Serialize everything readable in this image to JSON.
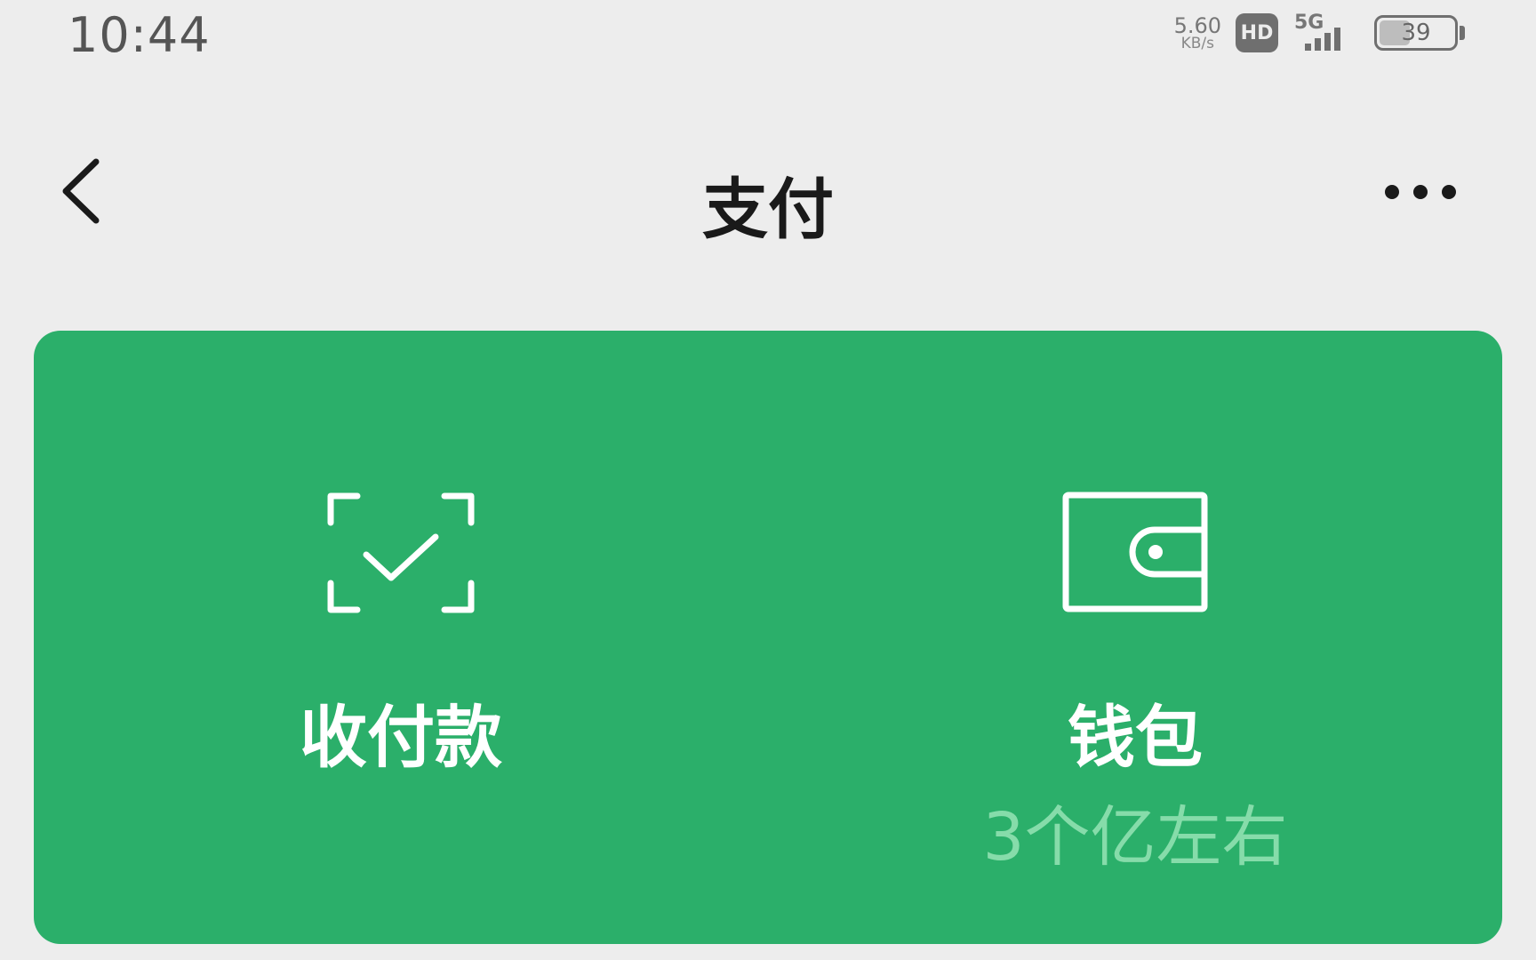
{
  "status_bar": {
    "time": "10:44",
    "net_speed_value": "5.60",
    "net_speed_unit": "KB/s",
    "hd_label": "HD",
    "network_label": "5G",
    "battery_level": "39"
  },
  "nav": {
    "title": "支付",
    "back_icon": "chevron-left-icon",
    "more_icon": "more-dots-icon"
  },
  "pay_card": {
    "background_color": "#2baf6a",
    "items": [
      {
        "label": "收付款",
        "icon": "scan-check-icon",
        "sub": ""
      },
      {
        "label": "钱包",
        "icon": "wallet-icon",
        "sub": "3个亿左右"
      }
    ]
  }
}
